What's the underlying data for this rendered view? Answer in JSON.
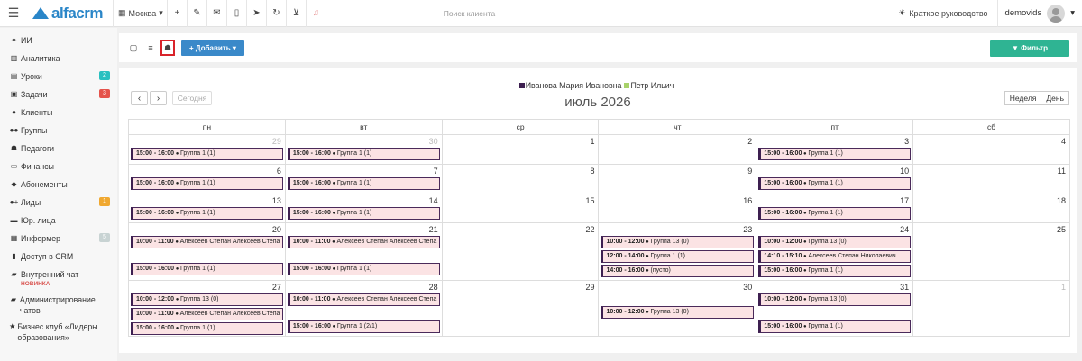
{
  "topbar": {
    "city": "Москва",
    "search_placeholder": "Поиск клиента",
    "guide": "Краткое руководство",
    "user": "demovids",
    "logo": "alfacrm"
  },
  "sidebar": {
    "items": [
      {
        "label": "ИИ",
        "icon": "sparkle-icon"
      },
      {
        "label": "Аналитика",
        "icon": "chart-icon"
      },
      {
        "label": "Уроки",
        "icon": "calendar-icon",
        "badge": "2",
        "badge_color": "#2ac0c0"
      },
      {
        "label": "Задачи",
        "icon": "clipboard-icon",
        "badge": "3",
        "badge_color": "#e5534b"
      },
      {
        "label": "Клиенты",
        "icon": "user-icon"
      },
      {
        "label": "Группы",
        "icon": "users-icon"
      },
      {
        "label": "Педагоги",
        "icon": "graduation-cap-icon"
      },
      {
        "label": "Финансы",
        "icon": "money-icon"
      },
      {
        "label": "Абонементы",
        "icon": "tag-icon"
      },
      {
        "label": "Лиды",
        "icon": "user-plus-icon",
        "badge": "1",
        "badge_color": "#f0a830"
      },
      {
        "label": "Юр. лица",
        "icon": "briefcase-icon"
      },
      {
        "label": "Информер",
        "icon": "mail-icon",
        "badge": "5",
        "badge_color": "#c8d3d3"
      },
      {
        "label": "Доступ в CRM",
        "icon": "lock-icon"
      },
      {
        "label": "Внутренний чат",
        "icon": "chat-icon",
        "sub": "НОВИНКА"
      },
      {
        "label": "Администрирование чатов",
        "icon": "chat-admin-icon"
      },
      {
        "label": "Бизнес клуб «Лидеры образования»",
        "icon": "star-icon"
      }
    ]
  },
  "toolbar": {
    "add_label": "+ Добавить ▾",
    "filter_label": "▼ Фильтр"
  },
  "calendar": {
    "legend": [
      {
        "name": "Иванова Мария Ивановна",
        "color": "#3d1f50"
      },
      {
        "name": "Петр Ильич",
        "color": "#a8d26a"
      }
    ],
    "title": "июль 2026",
    "today_label": "Сегодня",
    "week_label": "Неделя",
    "day_label": "День",
    "weekdays": [
      "пн",
      "вт",
      "ср",
      "чт",
      "пт",
      "сб"
    ],
    "weeks": [
      {
        "days": [
          {
            "num": "29",
            "other": true,
            "events": [
              {
                "time": "15:00 - 16:00",
                "text": "Группа 1 (1)"
              }
            ]
          },
          {
            "num": "30",
            "other": true,
            "events": [
              {
                "time": "15:00 - 16:00",
                "text": "Группа 1 (1)"
              }
            ]
          },
          {
            "num": "1",
            "events": []
          },
          {
            "num": "2",
            "events": []
          },
          {
            "num": "3",
            "events": [
              {
                "time": "15:00 - 16:00",
                "text": "Группа 1 (1)"
              }
            ]
          },
          {
            "num": "4",
            "events": []
          }
        ]
      },
      {
        "days": [
          {
            "num": "6",
            "events": [
              {
                "time": "15:00 - 16:00",
                "text": "Группа 1 (1)"
              }
            ]
          },
          {
            "num": "7",
            "events": [
              {
                "time": "15:00 - 16:00",
                "text": "Группа 1 (1)"
              }
            ]
          },
          {
            "num": "8",
            "events": []
          },
          {
            "num": "9",
            "events": []
          },
          {
            "num": "10",
            "events": [
              {
                "time": "15:00 - 16:00",
                "text": "Группа 1 (1)"
              }
            ]
          },
          {
            "num": "11",
            "events": []
          }
        ]
      },
      {
        "days": [
          {
            "num": "13",
            "events": [
              {
                "time": "15:00 - 16:00",
                "text": "Группа 1 (1)"
              }
            ]
          },
          {
            "num": "14",
            "events": [
              {
                "time": "15:00 - 16:00",
                "text": "Группа 1 (1)"
              }
            ]
          },
          {
            "num": "15",
            "events": []
          },
          {
            "num": "16",
            "events": []
          },
          {
            "num": "17",
            "events": [
              {
                "time": "15:00 - 16:00",
                "text": "Группа 1 (1)"
              }
            ]
          },
          {
            "num": "18",
            "events": []
          }
        ]
      },
      {
        "days": [
          {
            "num": "20",
            "events": [
              {
                "time": "10:00 - 11:00",
                "text": "Алексеев Степан Алексеев Степа"
              },
              {
                "time": "15:00 - 16:00",
                "text": "Группа 1 (1)",
                "gap": true
              }
            ]
          },
          {
            "num": "21",
            "events": [
              {
                "time": "10:00 - 11:00",
                "text": "Алексеев Степан Алексеев Степа"
              },
              {
                "time": "15:00 - 16:00",
                "text": "Группа 1 (1)",
                "gap": true
              }
            ]
          },
          {
            "num": "22",
            "events": []
          },
          {
            "num": "23",
            "events": [
              {
                "time": "10:00 - 12:00",
                "text": "Группа 13 (0)"
              },
              {
                "time": "12:00 - 14:00",
                "text": "Группа 1 (1)"
              },
              {
                "time": "14:00 - 16:00",
                "text": "(пусто)"
              }
            ]
          },
          {
            "num": "24",
            "events": [
              {
                "time": "10:00 - 12:00",
                "text": "Группа 13 (0)"
              },
              {
                "time": "14:10 - 15:10",
                "text": "Алексеев Степан Николаевич"
              },
              {
                "time": "15:00 - 16:00",
                "text": "Группа 1 (1)"
              }
            ]
          },
          {
            "num": "25",
            "events": []
          }
        ]
      },
      {
        "days": [
          {
            "num": "27",
            "events": [
              {
                "time": "10:00 - 12:00",
                "text": "Группа 13 (0)"
              },
              {
                "time": "10:00 - 11:00",
                "text": "Алексеев Степан Алексеев Степа"
              },
              {
                "time": "15:00 - 16:00",
                "text": "Группа 1 (1)"
              }
            ]
          },
          {
            "num": "28",
            "events": [
              {
                "time": "10:00 - 11:00",
                "text": "Алексеев Степан Алексеев Степа"
              },
              {
                "time": "15:00 - 16:00",
                "text": "Группа 1 (2/1)",
                "gap": true
              }
            ]
          },
          {
            "num": "29",
            "events": []
          },
          {
            "num": "30",
            "events": [
              {
                "time": "10:00 - 12:00",
                "text": "Группа 13 (0)",
                "gap": true
              }
            ]
          },
          {
            "num": "31",
            "events": [
              {
                "time": "10:00 - 12:00",
                "text": "Группа 13 (0)"
              },
              {
                "time": "15:00 - 16:00",
                "text": "Группа 1 (1)",
                "gap": true
              }
            ]
          },
          {
            "num": "1",
            "other": true,
            "events": []
          }
        ]
      }
    ]
  }
}
